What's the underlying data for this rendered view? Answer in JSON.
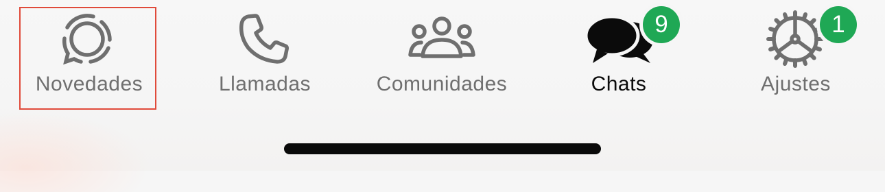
{
  "colors": {
    "inactive": "#6f6f6f",
    "active": "#0b0b0b",
    "badge": "#1fa855",
    "highlight": "#e04a3a"
  },
  "tabs": [
    {
      "label": "Novedades",
      "icon": "updates-icon",
      "selected_highlight": true
    },
    {
      "label": "Llamadas",
      "icon": "phone-icon"
    },
    {
      "label": "Comunidades",
      "icon": "communities-icon"
    },
    {
      "label": "Chats",
      "icon": "chats-icon",
      "active": true,
      "badge": "9"
    },
    {
      "label": "Ajustes",
      "icon": "settings-gear-icon",
      "badge": "1"
    }
  ]
}
